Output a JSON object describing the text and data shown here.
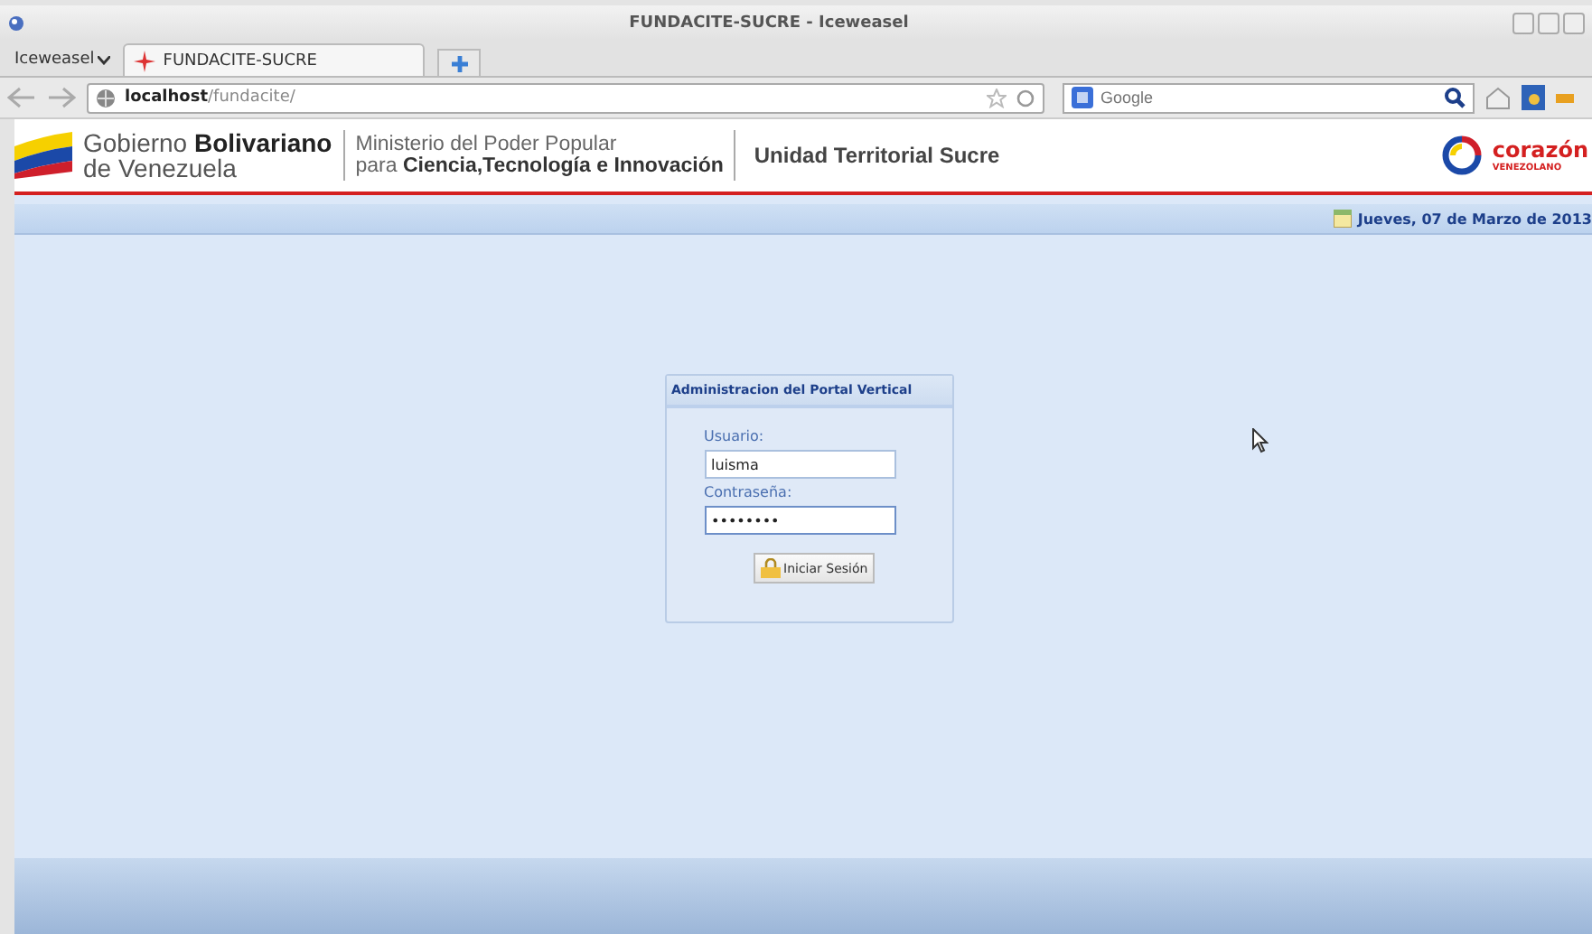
{
  "window": {
    "title": "FUNDACITE-SUCRE - Iceweasel"
  },
  "app_menu": "Iceweasel",
  "tabs": [
    {
      "label": "FUNDACITE-SUCRE",
      "selected": true
    }
  ],
  "address_bar": {
    "host": "localhost",
    "path": "/fundacite/"
  },
  "search": {
    "placeholder": "Google"
  },
  "header": {
    "gov_line1_plain": "Gobierno ",
    "gov_line1_bold": "Bolivariano",
    "gov_line2": "de Venezuela",
    "ministry_line1": "Ministerio del Poder Popular",
    "ministry_line2": "para **Ciencia,Tecnología e Innovación**",
    "unit": "Unidad Territorial Sucre",
    "logo_word": "corazón",
    "logo_sub": "VENEZOLANO"
  },
  "date": "Jueves, 07 de Marzo de 2013",
  "login": {
    "title": "Administracion del Portal Vertical",
    "fields": [
      {
        "label": "Usuario:",
        "value": "luisma",
        "focused": false
      },
      {
        "label": "Contraseña:",
        "value": "••••••••",
        "focused": true
      }
    ],
    "button": "Iniciar Sesión"
  }
}
